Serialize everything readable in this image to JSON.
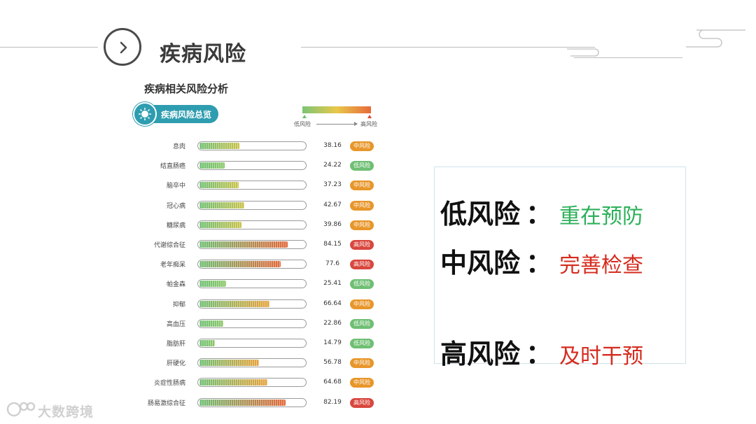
{
  "slide": {
    "title": "疾病风险"
  },
  "chart": {
    "title": "疾病相关风险分析",
    "overview_label": "疾病风险总览"
  },
  "legend": {
    "low": "低风险",
    "high": "高风险"
  },
  "colors": {
    "low": "#6fbf73",
    "mid": "#e8962a",
    "high": "#d9473d"
  },
  "chart_data": {
    "type": "bar",
    "title": "疾病相关风险分析",
    "xlim": [
      0,
      100
    ],
    "categories": [
      "息肉",
      "结直肠癌",
      "脑卒中",
      "冠心病",
      "糖尿病",
      "代谢综合征",
      "老年痴呆",
      "帕金森",
      "抑郁",
      "高血压",
      "脂肪肝",
      "肝硬化",
      "炎症性肠病",
      "肠易激综合征"
    ],
    "values": [
      38.16,
      24.22,
      37.23,
      42.67,
      39.86,
      84.15,
      77.6,
      25.41,
      66.64,
      22.86,
      14.79,
      56.78,
      64.68,
      82.19
    ],
    "levels": [
      "中风险",
      "低风险",
      "中风险",
      "中风险",
      "中风险",
      "高风险",
      "高风险",
      "低风险",
      "中风险",
      "低风险",
      "低风险",
      "中风险",
      "中风险",
      "高风险"
    ],
    "value_labels": [
      "38.16",
      "24.22",
      "37.23",
      "42.67",
      "39.86",
      "84.15",
      "77.6",
      "25.41",
      "66.64",
      "22.86",
      "14.79",
      "56.78",
      "64.68",
      "82.19"
    ]
  },
  "advice": [
    {
      "level": "低风险",
      "sep": "：",
      "text": "重在预防",
      "color": "#2db05a"
    },
    {
      "level": "中风险",
      "sep": "：",
      "text": "完善检查",
      "color": "#d52b1e"
    },
    {
      "level": "高风险",
      "sep": "：",
      "text": "及时干预",
      "color": "#d52b1e"
    }
  ],
  "watermark": {
    "text": "大数跨境"
  }
}
